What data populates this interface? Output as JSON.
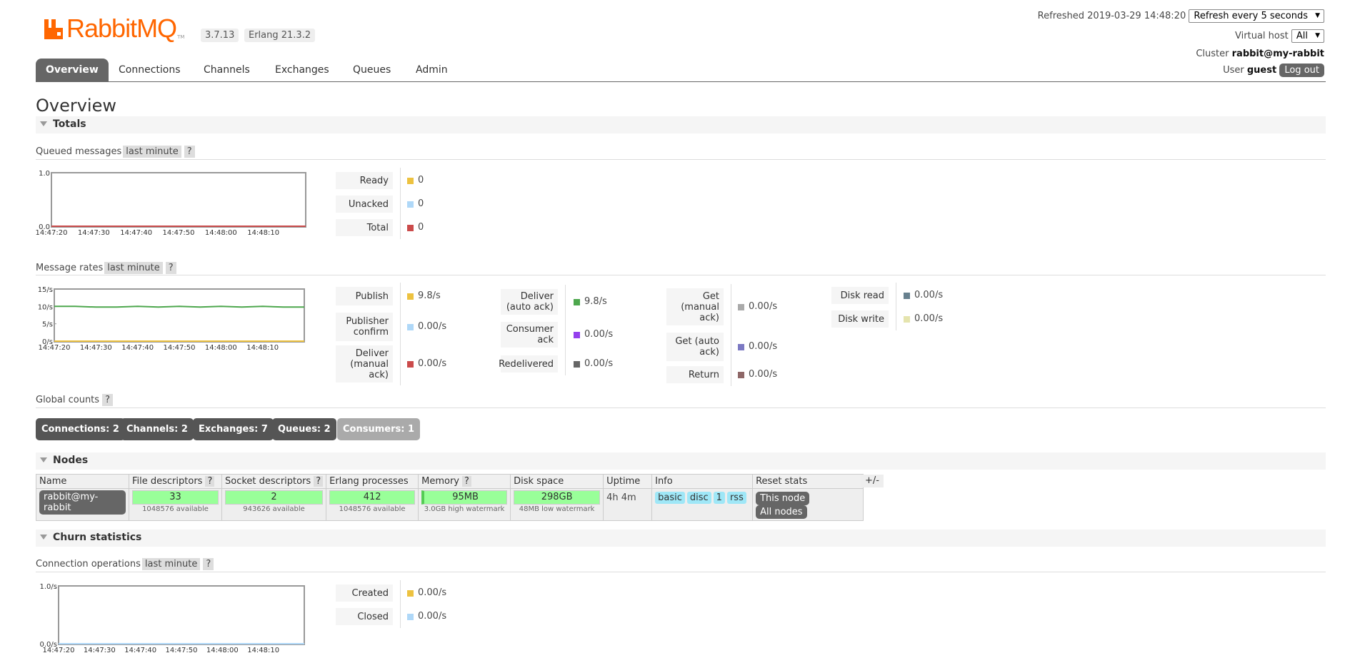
{
  "app": {
    "logo": "RabbitMQ",
    "tm": "TM",
    "version": "3.7.13",
    "erlang": "Erlang 21.3.2"
  },
  "header": {
    "refreshed_label": "Refreshed",
    "refreshed_time": "2019-03-29 14:48:20",
    "refresh_select": "Refresh every 5 seconds",
    "vhost_label": "Virtual host",
    "vhost_value": "All",
    "cluster_label": "Cluster",
    "cluster_value": "rabbit@my-rabbit",
    "user_label": "User",
    "user_value": "guest",
    "logout": "Log out"
  },
  "tabs": [
    "Overview",
    "Connections",
    "Channels",
    "Exchanges",
    "Queues",
    "Admin"
  ],
  "page_title": "Overview",
  "sections": {
    "totals": "Totals",
    "nodes": "Nodes",
    "churn": "Churn statistics"
  },
  "queued": {
    "title": "Queued messages",
    "range": "last minute",
    "help": "?",
    "yticks": [
      "1.0",
      "0.0"
    ],
    "xticks": [
      "14:47:20",
      "14:47:30",
      "14:47:40",
      "14:47:50",
      "14:48:00",
      "14:48:10"
    ],
    "rows": [
      {
        "label": "Ready",
        "value": "0",
        "color": "#edc240"
      },
      {
        "label": "Unacked",
        "value": "0",
        "color": "#afd8f8"
      },
      {
        "label": "Total",
        "value": "0",
        "color": "#cb4b4b"
      }
    ]
  },
  "rates": {
    "title": "Message rates",
    "range": "last minute",
    "help": "?",
    "yticks": [
      "15/s",
      "10/s",
      "5/s",
      "0/s"
    ],
    "xticks": [
      "14:47:20",
      "14:47:30",
      "14:47:40",
      "14:47:50",
      "14:48:00",
      "14:48:10"
    ],
    "col1": [
      {
        "label": "Publish",
        "value": "9.8/s",
        "color": "#edc240"
      },
      {
        "label": "Publisher confirm",
        "value": "0.00/s",
        "color": "#afd8f8"
      },
      {
        "label": "Deliver (manual ack)",
        "value": "0.00/s",
        "color": "#cb4b4b"
      }
    ],
    "col2": [
      {
        "label": "Deliver (auto ack)",
        "value": "9.8/s",
        "color": "#4da74d"
      },
      {
        "label": "Consumer ack",
        "value": "0.00/s",
        "color": "#9440ed"
      },
      {
        "label": "Redelivered",
        "value": "0.00/s",
        "color": "#666666"
      }
    ],
    "col3": [
      {
        "label": "Get (manual ack)",
        "value": "0.00/s",
        "color": "#aaaaaa"
      },
      {
        "label": "Get (auto ack)",
        "value": "0.00/s",
        "color": "#7c79c3"
      },
      {
        "label": "Return",
        "value": "0.00/s",
        "color": "#8e6767"
      }
    ],
    "col4": [
      {
        "label": "Disk read",
        "value": "0.00/s",
        "color": "#67808e"
      },
      {
        "label": "Disk write",
        "value": "0.00/s",
        "color": "#e5e4ae"
      }
    ]
  },
  "chart_data": [
    {
      "type": "line",
      "title": "Queued messages",
      "x": [
        "14:47:20",
        "14:47:30",
        "14:47:40",
        "14:47:50",
        "14:48:00",
        "14:48:10",
        "14:48:20"
      ],
      "series": [
        {
          "name": "Ready",
          "values": [
            0,
            0,
            0,
            0,
            0,
            0,
            0
          ]
        },
        {
          "name": "Unacked",
          "values": [
            0,
            0,
            0,
            0,
            0,
            0,
            0
          ]
        },
        {
          "name": "Total",
          "values": [
            0,
            0,
            0,
            0,
            0,
            0,
            0
          ]
        }
      ],
      "ylim": [
        0,
        1
      ]
    },
    {
      "type": "line",
      "title": "Message rates",
      "x": [
        "14:47:20",
        "14:47:25",
        "14:47:30",
        "14:47:35",
        "14:47:40",
        "14:47:45",
        "14:47:50",
        "14:47:55",
        "14:48:00",
        "14:48:05",
        "14:48:10",
        "14:48:15",
        "14:48:20"
      ],
      "series": [
        {
          "name": "Deliver (auto ack)",
          "values": [
            10.0,
            10.0,
            9.8,
            9.8,
            10.0,
            9.8,
            10.0,
            9.8,
            10.0,
            9.8,
            10.0,
            9.8,
            9.8
          ]
        },
        {
          "name": "Publish",
          "values": [
            0,
            0,
            0,
            0,
            0,
            0,
            0,
            0,
            0,
            0,
            0,
            0,
            0
          ]
        }
      ],
      "ylim": [
        0,
        15
      ]
    },
    {
      "type": "line",
      "title": "Connection operations",
      "x": [
        "14:47:20",
        "14:47:30",
        "14:47:40",
        "14:47:50",
        "14:48:00",
        "14:48:10",
        "14:48:20"
      ],
      "series": [
        {
          "name": "Created",
          "values": [
            0,
            0,
            0,
            0,
            0,
            0,
            0
          ]
        },
        {
          "name": "Closed",
          "values": [
            0,
            0,
            0,
            0,
            0,
            0,
            0
          ]
        }
      ],
      "ylim": [
        0,
        1
      ]
    }
  ],
  "global": {
    "title": "Global counts",
    "help": "?",
    "buttons": [
      "Connections: 2",
      "Channels: 2",
      "Exchanges: 7",
      "Queues: 2",
      "Consumers: 1"
    ]
  },
  "nodes": {
    "headers": [
      "Name",
      "File descriptors",
      "Socket descriptors",
      "Erlang processes",
      "Memory",
      "Disk space",
      "Uptime",
      "Info",
      "Reset stats"
    ],
    "help": "?",
    "plusminus": "+/-",
    "row": {
      "name": "rabbit@my-rabbit",
      "fd": "33",
      "fd_sub": "1048576 available",
      "sd": "2",
      "sd_sub": "943626 available",
      "ep": "412",
      "ep_sub": "1048576 available",
      "mem": "95MB",
      "mem_sub": "3.0GB high watermark",
      "disk": "298GB",
      "disk_sub": "48MB low watermark",
      "uptime": "4h 4m",
      "info": [
        "basic",
        "disc",
        "1",
        "rss"
      ],
      "reset": [
        "This node",
        "All nodes"
      ]
    }
  },
  "churn": {
    "title": "Connection operations",
    "range": "last minute",
    "help": "?",
    "yticks": [
      "1.0/s",
      "0.0/s"
    ],
    "xticks": [
      "14:47:20",
      "14:47:30",
      "14:47:40",
      "14:47:50",
      "14:48:00",
      "14:48:10"
    ],
    "rows": [
      {
        "label": "Created",
        "value": "0.00/s",
        "color": "#edc240"
      },
      {
        "label": "Closed",
        "value": "0.00/s",
        "color": "#afd8f8"
      }
    ]
  }
}
